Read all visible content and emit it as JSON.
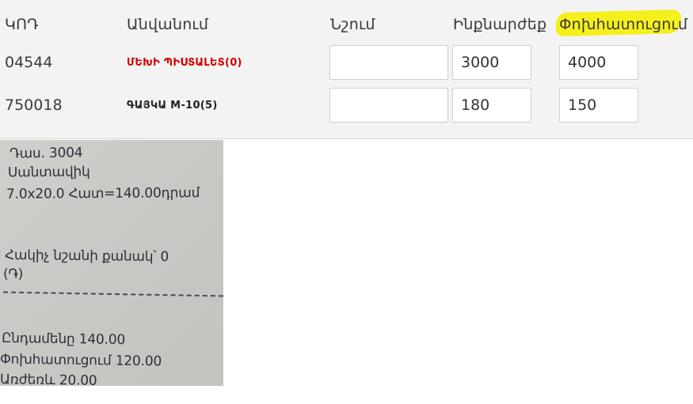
{
  "table": {
    "headers": [
      "ԿՈԴ",
      "Անվանում",
      "Նշում",
      "Ինքնարժեք",
      "Փոխհատուցում"
    ],
    "rows": [
      {
        "code": "04544",
        "name": "ՄԵԽԻ ՊԻՍՏԱԼԵՏ(0)",
        "name_color": "#d40000",
        "note": "",
        "cost": "3000",
        "compensation": "4000"
      },
      {
        "code": "750018",
        "name": "ԳԱՅԿԱ M-10(5)",
        "name_color": "#222222",
        "note": "",
        "cost": "180",
        "compensation": "150"
      }
    ]
  },
  "highlight_color": "#f5ef1c",
  "receipt": {
    "lines": [
      "Դաս. 3004",
      "Սանտավիկ",
      "7.0x20.0 Հատ=140.00դրամ",
      "Հակիչ նշանի քանակ՝ 0",
      "(֏)",
      "Ընդամենը   140.00",
      "Փոխհատուցում  120.00",
      "Առժեռև   20.00"
    ]
  }
}
